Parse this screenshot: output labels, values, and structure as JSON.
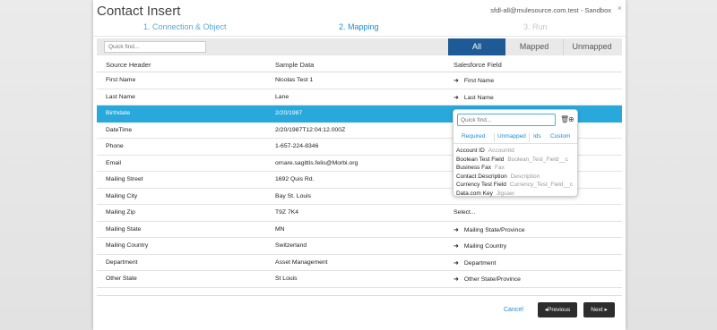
{
  "dialog": {
    "title": "Contact Insert",
    "account": "sfdl-all@mulesource.com.test - Sandbox",
    "close_glyph": "×"
  },
  "steps": [
    {
      "label": "1. Connection & Object",
      "state": "done"
    },
    {
      "label": "2. Mapping",
      "state": "active"
    },
    {
      "label": "3. Run",
      "state": "pending"
    }
  ],
  "toolbar": {
    "search_placeholder": "Quick find...",
    "filters": [
      "All",
      "Mapped",
      "Unmapped"
    ],
    "active_filter": "All",
    "active_color": "#1e5b96"
  },
  "table": {
    "headers": [
      "Source Header",
      "Sample Data",
      "Salesforce Field"
    ],
    "selected_color": "#29a8dc",
    "rows": [
      {
        "source": "First Name",
        "sample": "Nicolas Test 1",
        "field": "First Name",
        "arrow": "➜"
      },
      {
        "source": "Last Name",
        "sample": "Lane",
        "field": "Last Name",
        "arrow": "➜"
      },
      {
        "source": "Birthdate",
        "sample": "2/20/1987",
        "field": "",
        "arrow": ""
      },
      {
        "source": "DateTime",
        "sample": "2/20/1987T12:04:12.000Z",
        "field": "",
        "arrow": ""
      },
      {
        "source": "Phone",
        "sample": "1-657-224-8346",
        "field": "",
        "arrow": ""
      },
      {
        "source": "Email",
        "sample": "ornare.sagittis.felis@Morbi.org",
        "field": "",
        "arrow": ""
      },
      {
        "source": "Mailing Street",
        "sample": "1692 Quis Rd.",
        "field": "",
        "arrow": ""
      },
      {
        "source": "Mailing City",
        "sample": "Bay St. Louis",
        "field": "",
        "arrow": ""
      },
      {
        "source": "Mailing Zip",
        "sample": "T9Z 7K4",
        "field": "Select...",
        "arrow": ""
      },
      {
        "source": "Mailing State",
        "sample": "MN",
        "field": "Mailing State/Province",
        "arrow": "➜"
      },
      {
        "source": "Mailing Country",
        "sample": "Switzerland",
        "field": "Mailing Country",
        "arrow": "➜"
      },
      {
        "source": "Department",
        "sample": "Asset Management",
        "field": "Department",
        "arrow": "➜"
      },
      {
        "source": "Other State",
        "sample": "St Louis",
        "field": "Other State/Province",
        "arrow": "➜"
      }
    ]
  },
  "popup": {
    "search_placeholder": "Quick find...",
    "trash_glyph": "🗑",
    "plus_glyph": "⊕",
    "tabs": [
      "Required",
      "Unmapped",
      "Ids",
      "Custom"
    ],
    "active_tab": "Unmapped",
    "items": [
      {
        "name": "Account ID",
        "api": "AccountId"
      },
      {
        "name": "Boolean Test Field",
        "api": "Boolean_Test_Field__c"
      },
      {
        "name": "Business Fax",
        "api": "Fax"
      },
      {
        "name": "Contact Description",
        "api": "Description"
      },
      {
        "name": "Currency Test Field",
        "api": "Currency_Test_Field__c"
      },
      {
        "name": "Data.com Key",
        "api": "Jigsaw"
      }
    ]
  },
  "footer": {
    "cancel_label": "Cancel",
    "previous_label": "◂Previous",
    "next_label": "Next ▸"
  }
}
